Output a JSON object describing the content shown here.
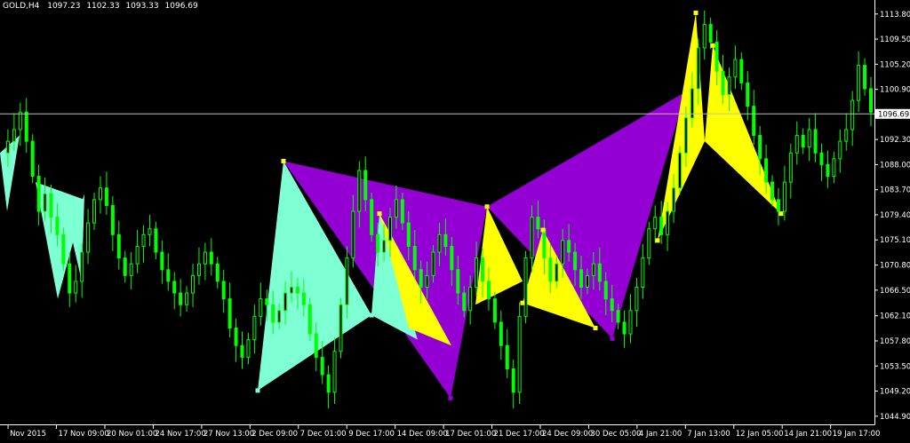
{
  "header": {
    "symbol": "GOLD,H4",
    "open": "1097.23",
    "high": "1102.33",
    "low": "1093.33",
    "close": "1096.69"
  },
  "current_price_label": "1096.69",
  "colors": {
    "background": "#000000",
    "candle": "#00ff00",
    "aqua_fill": "#7fffd4",
    "yellow_fill": "#ffff00",
    "purple_fill": "#9400d3",
    "price_line": "#c0c0c0",
    "axis": "#ffffff"
  },
  "chart_data": {
    "type": "line",
    "ylim": [
      1043.5,
      1116.2
    ],
    "y_ticks": [
      "1113.80",
      "1109.50",
      "1105.20",
      "1100.90",
      "1096.69",
      "1092.30",
      "1088.00",
      "1083.70",
      "1079.40",
      "1075.10",
      "1070.80",
      "1066.50",
      "1062.10",
      "1057.80",
      "1053.50",
      "1049.20",
      "1044.90"
    ],
    "x_ticks": [
      "Nov 2015",
      "17 Nov 09:00",
      "20 Nov 01:00",
      "24 Nov 17:00",
      "27 Nov 13:00",
      "2 Dec 09:00",
      "7 Dec 01:00",
      "9 Dec 17:00",
      "14 Dec 09:00",
      "17 Dec 01:00",
      "21 Dec 17:00",
      "24 Dec 09:00",
      "30 Dec 05:00",
      "4 Jan 21:00",
      "7 Jan 13:00",
      "12 Jan 05:00",
      "14 Jan 21:00",
      "19 Jan 17:00"
    ],
    "current_price": 1096.69,
    "pattern_pivots": [
      1049.3,
      1088.6,
      1062.2,
      1079.6,
      1048.0,
      1080.8,
      1064.3,
      1076.8,
      1060.0,
      1058.2,
      1075.0,
      1114.0,
      1108.4,
      1079.6
    ],
    "price_series": [
      1090,
      1092,
      1094,
      1097,
      1092,
      1086,
      1080,
      1083,
      1079,
      1076,
      1071,
      1066,
      1068,
      1073,
      1078,
      1082,
      1084,
      1081,
      1076,
      1072,
      1069,
      1071,
      1074,
      1076,
      1077,
      1073,
      1070,
      1068,
      1066,
      1064,
      1066,
      1069,
      1071,
      1073,
      1071,
      1068,
      1065,
      1060,
      1057,
      1055,
      1058,
      1062,
      1065,
      1064,
      1061,
      1063,
      1066,
      1067,
      1066,
      1064,
      1059,
      1055,
      1052,
      1049,
      1056,
      1064,
      1072,
      1080,
      1087,
      1082,
      1076,
      1073,
      1075,
      1079,
      1082,
      1078,
      1074,
      1070,
      1067,
      1069,
      1073,
      1076,
      1074,
      1070,
      1066,
      1063,
      1067,
      1072,
      1068,
      1065,
      1061,
      1057,
      1053,
      1049,
      1062,
      1072,
      1079,
      1077,
      1072,
      1068,
      1071,
      1075,
      1073,
      1070,
      1067,
      1069,
      1071,
      1068,
      1065,
      1063,
      1061,
      1059,
      1063,
      1067,
      1072,
      1077,
      1079,
      1076,
      1080,
      1084,
      1090,
      1096,
      1101,
      1108,
      1112,
      1109,
      1104,
      1100,
      1103,
      1106,
      1102,
      1098,
      1093,
      1089,
      1085,
      1082,
      1080,
      1085,
      1090,
      1093,
      1091,
      1094,
      1090,
      1088,
      1086,
      1089,
      1092,
      1094,
      1099,
      1105,
      1101,
      1097
    ]
  }
}
